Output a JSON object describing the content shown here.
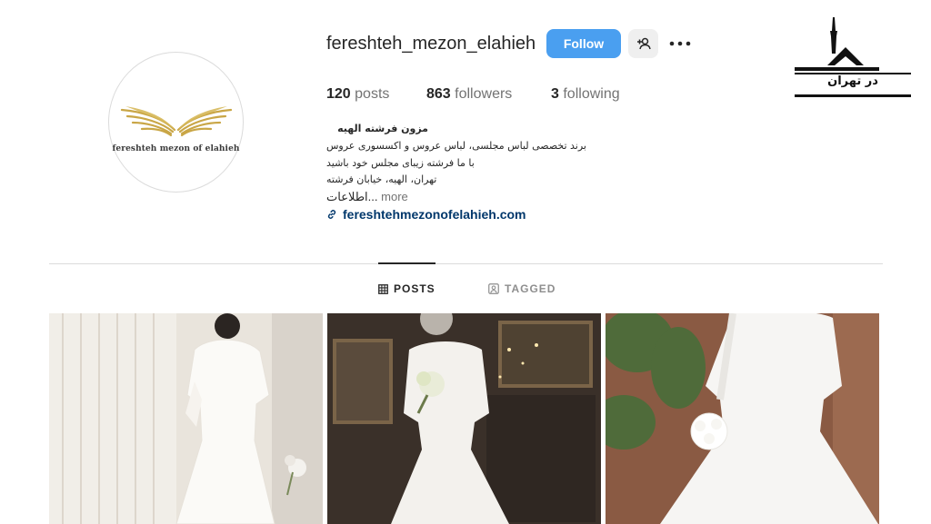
{
  "profile": {
    "username": "fereshteh_mezon_elahieh",
    "avatar_text": "fereshteh mezon of elahieh",
    "follow_label": "Follow",
    "stats": {
      "posts_count": "120",
      "posts_label": "posts",
      "followers_count": "863",
      "followers_label": "followers",
      "following_count": "3",
      "following_label": "following"
    },
    "bio": {
      "name": "مزون فرشته الهیه",
      "line1": "برند تخصصی لباس مجلسی، لباس عروس و اکسسوری عروس",
      "line2": "با ما فرشته زیبای مجلس خود باشید",
      "line3": "تهران، الهیه، خیابان فرشته",
      "line4": "اطلاعات...",
      "more_label": "more",
      "link": "fereshtehmezonofelahieh.com"
    }
  },
  "tabs": [
    {
      "label": "POSTS",
      "active": true
    },
    {
      "label": "TAGGED",
      "active": false
    }
  ],
  "posts": [
    {
      "alt": "white lace dress by window"
    },
    {
      "alt": "bride in satin gown with bouquet"
    },
    {
      "alt": "lace wedding gown with roses bouquet"
    }
  ],
  "watermark": {
    "text": "در تهران"
  },
  "colors": {
    "follow_button": "#4a9ff0",
    "link": "#00376b",
    "gold": "#c9a646"
  }
}
